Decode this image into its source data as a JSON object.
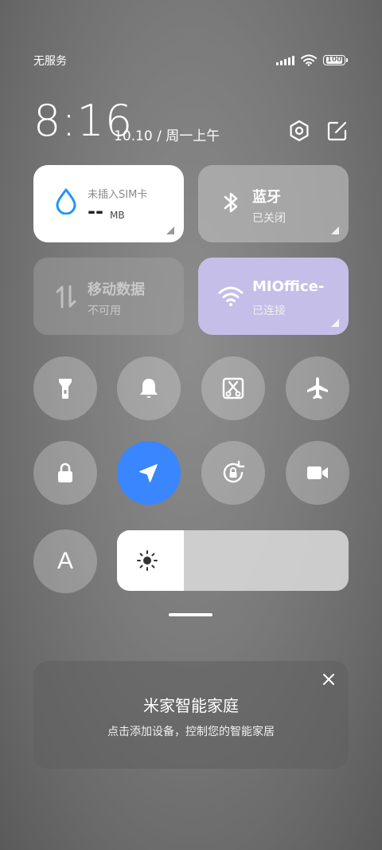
{
  "status_bar": {
    "carrier": "无服务",
    "battery_level": "100",
    "icons": [
      "signal-icon",
      "wifi-icon",
      "battery-icon"
    ]
  },
  "header": {
    "time": "8:16",
    "date": "10.10 / 周一上午",
    "icons": [
      "settings-icon",
      "edit-icon"
    ]
  },
  "tiles": {
    "data_usage": {
      "label": "未插入SIM卡",
      "value": "--",
      "unit": "MB",
      "icon": "water-drop-icon"
    },
    "bluetooth": {
      "label": "蓝牙",
      "status": "已关闭",
      "icon": "bluetooth-icon"
    },
    "mobile_data": {
      "label": "移动数据",
      "status": "不可用",
      "icon": "mobile-data-icon"
    },
    "wifi": {
      "label": "MIOffice-",
      "status": "已连接",
      "icon": "wifi-icon"
    }
  },
  "toggles_row1": [
    "flashlight-icon",
    "bell-icon",
    "screenshot-icon",
    "airplane-icon"
  ],
  "toggles_row2": [
    "lock-icon",
    "location-icon",
    "rotation-lock-icon",
    "video-camera-icon"
  ],
  "auto_brightness": {
    "label": "A"
  },
  "brightness": {
    "level": 0.29,
    "icon": "sun-icon"
  },
  "mijia_card": {
    "title": "米家智能家庭",
    "subtitle": "点击添加设备，控制您的智能家居"
  },
  "colors": {
    "tile_active_white": "#ffffff",
    "tile_inactive": "#a7a7a7",
    "wifi_tile": "#c4bee8",
    "location_active": "#3a86ff",
    "drop_blue": "#2196f3"
  }
}
